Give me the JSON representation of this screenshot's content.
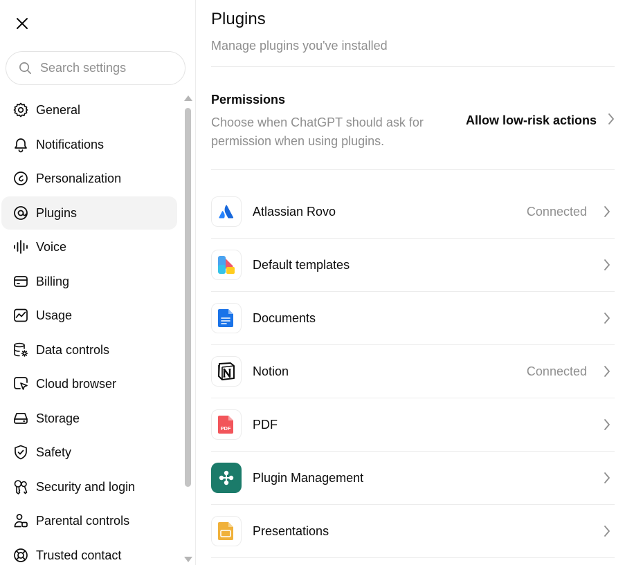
{
  "sidebar": {
    "search": {
      "placeholder": "Search settings"
    },
    "items": [
      {
        "label": "General",
        "icon": "gear-icon"
      },
      {
        "label": "Notifications",
        "icon": "bell-icon"
      },
      {
        "label": "Personalization",
        "icon": "personalization-icon"
      },
      {
        "label": "Plugins",
        "icon": "plugin-icon",
        "active": true
      },
      {
        "label": "Voice",
        "icon": "waveform-icon"
      },
      {
        "label": "Billing",
        "icon": "credit-card-icon"
      },
      {
        "label": "Usage",
        "icon": "chart-icon"
      },
      {
        "label": "Data controls",
        "icon": "database-gear-icon"
      },
      {
        "label": "Cloud browser",
        "icon": "cursor-window-icon"
      },
      {
        "label": "Storage",
        "icon": "hard-drive-icon"
      },
      {
        "label": "Safety",
        "icon": "shield-check-icon"
      },
      {
        "label": "Security and login",
        "icon": "keys-icon"
      },
      {
        "label": "Parental controls",
        "icon": "parent-user-icon"
      },
      {
        "label": "Trusted contact",
        "icon": "lifebuoy-icon"
      }
    ]
  },
  "main": {
    "title": "Plugins",
    "subtitle": "Manage plugins you've installed",
    "permissions": {
      "title": "Permissions",
      "description": "Choose when ChatGPT should ask for permission when using plugins.",
      "action_label": "Allow low-risk actions"
    },
    "plugins": [
      {
        "name": "Atlassian Rovo",
        "status": "Connected",
        "icon": "atlassian-icon"
      },
      {
        "name": "Default templates",
        "status": "",
        "icon": "templates-icon"
      },
      {
        "name": "Documents",
        "status": "",
        "icon": "document-icon"
      },
      {
        "name": "Notion",
        "status": "Connected",
        "icon": "notion-icon"
      },
      {
        "name": "PDF",
        "status": "",
        "icon": "pdf-icon",
        "icon_text": "PDF"
      },
      {
        "name": "Plugin Management",
        "status": "",
        "icon": "plugin-management-icon"
      },
      {
        "name": "Presentations",
        "status": "",
        "icon": "presentation-icon"
      }
    ]
  },
  "colors": {
    "text": "#0d0d0d",
    "muted": "#8f8f8f",
    "active_bg": "#f3f3f3",
    "border": "#ececec",
    "atlassian_blue": "#1868db",
    "documents_blue": "#1a73e8",
    "pdf_red": "#f2555a",
    "plugin_mgmt_teal": "#1b7b6a",
    "presentation_orange": "#e89a2c"
  }
}
